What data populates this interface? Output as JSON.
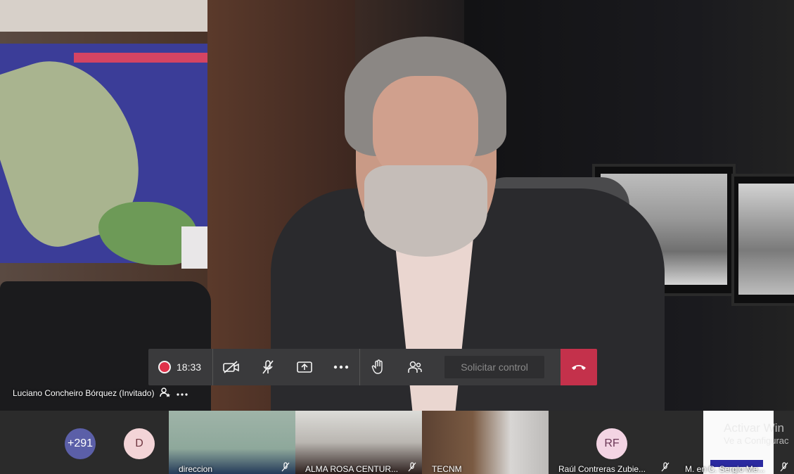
{
  "meeting": {
    "timer": "18:33",
    "request_control_label": "Solicitar control"
  },
  "speaker": {
    "name": "Luciano Concheiro Bórquez (Invitado)"
  },
  "participants": {
    "overflow_count": "+291",
    "initial_d": "D",
    "tiles": [
      {
        "name": "direccion"
      },
      {
        "name": "ALMA ROSA CENTUR..."
      },
      {
        "name": "TECNM"
      },
      {
        "initials": "RF",
        "name": "Raúl Contreras Zubie..."
      },
      {
        "name": "M. en C. Sergio Me..."
      }
    ]
  },
  "watermark": {
    "line1": "Activar Win",
    "line2": "Ve a Configurac"
  },
  "colors": {
    "record": "#e0314a",
    "hangup": "#c4314b",
    "toolbar": "#3a3a3c",
    "avatar_more": "#5b5fa8"
  },
  "icons": {
    "record": "record-dot",
    "camera": "camera-off",
    "mic": "mic-off",
    "share": "share-screen",
    "more": "more-dots",
    "hand": "raise-hand",
    "people": "participants",
    "hangup": "phone-hangup"
  }
}
